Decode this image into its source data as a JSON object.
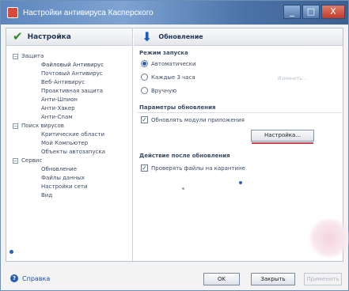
{
  "window": {
    "title": "Настройки антивируса Касперского",
    "controls": {
      "minimize": "_",
      "maximize": "□",
      "close": "X"
    }
  },
  "left_panel": {
    "header": "Настройка",
    "tree": [
      {
        "label": "Защита",
        "type": "group",
        "expander": "−"
      },
      {
        "label": "Файловый Антивирус",
        "type": "child"
      },
      {
        "label": "Почтовый Антивирус",
        "type": "child"
      },
      {
        "label": "Веб-Антивирус",
        "type": "child"
      },
      {
        "label": "Проактивная защита",
        "type": "child"
      },
      {
        "label": "Анти-Шпион",
        "type": "child"
      },
      {
        "label": "Анти-Хакер",
        "type": "child"
      },
      {
        "label": "Анти-Спам",
        "type": "child"
      },
      {
        "label": "Поиск вирусов",
        "type": "group",
        "expander": "−"
      },
      {
        "label": "Критические области",
        "type": "child"
      },
      {
        "label": "Мой Компьютер",
        "type": "child"
      },
      {
        "label": "Объекты автозапуска",
        "type": "child"
      },
      {
        "label": "Сервис",
        "type": "group",
        "expander": "−"
      },
      {
        "label": "Обновление",
        "type": "child"
      },
      {
        "label": "Файлы данных",
        "type": "child"
      },
      {
        "label": "Настройки сети",
        "type": "child"
      },
      {
        "label": "Вид",
        "type": "child"
      }
    ]
  },
  "right_panel": {
    "header": "Обновление",
    "run_mode": {
      "label": "Режим запуска",
      "options": [
        "Автоматически",
        "Каждые 3 часа",
        "Вручную"
      ],
      "selected": "Автоматически",
      "faint_right": "Изменить..."
    },
    "update_params": {
      "label": "Параметры обновления",
      "checkbox": "Обновлять модули приложения",
      "checkbox_checked": true,
      "button": "Настройка..."
    },
    "after_update": {
      "label": "Действие после обновления",
      "checkbox": "Проверять файлы на карантине",
      "checkbox_checked": true
    }
  },
  "footer": {
    "help": "Справка",
    "ok": "OK",
    "close": "Закрыть",
    "apply": "Применить"
  },
  "colors": {
    "title_bar": "#5c86bd",
    "accent": "#2a5db0",
    "close_button": "#c23b2a"
  }
}
